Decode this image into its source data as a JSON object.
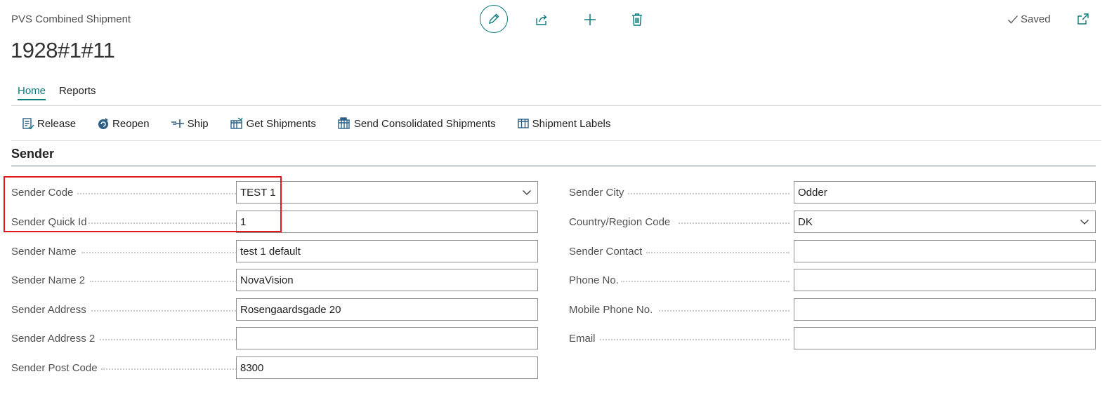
{
  "header": {
    "page_caption": "PVS Combined Shipment",
    "record_title": "1928#1#11",
    "saved_label": "Saved"
  },
  "tabs": [
    {
      "label": "Home",
      "active": true
    },
    {
      "label": "Reports",
      "active": false
    }
  ],
  "actions": [
    {
      "label": "Release",
      "icon": "release-icon"
    },
    {
      "label": "Reopen",
      "icon": "reopen-icon"
    },
    {
      "label": "Ship",
      "icon": "ship-icon"
    },
    {
      "label": "Get Shipments",
      "icon": "get-shipments-icon"
    },
    {
      "label": "Send Consolidated Shipments",
      "icon": "send-consolidated-icon"
    },
    {
      "label": "Shipment Labels",
      "icon": "shipment-labels-icon"
    }
  ],
  "section": {
    "title": "Sender",
    "left_fields": [
      {
        "label": "Sender Code",
        "value": "TEST 1",
        "dropdown": true
      },
      {
        "label": "Sender Quick Id",
        "value": "1",
        "dropdown": false
      },
      {
        "label": "Sender Name",
        "value": "test 1 default",
        "dropdown": false
      },
      {
        "label": "Sender Name 2",
        "value": "NovaVision",
        "dropdown": false
      },
      {
        "label": "Sender Address",
        "value": "Rosengaardsgade 20",
        "dropdown": false
      },
      {
        "label": "Sender Address 2",
        "value": "",
        "dropdown": false
      },
      {
        "label": "Sender Post Code",
        "value": "8300",
        "dropdown": false
      }
    ],
    "right_fields": [
      {
        "label": "Sender City",
        "value": "Odder",
        "dropdown": false
      },
      {
        "label": "Country/Region Code",
        "value": "DK",
        "dropdown": true
      },
      {
        "label": "Sender Contact",
        "value": "",
        "dropdown": false
      },
      {
        "label": "Phone No.",
        "value": "",
        "dropdown": false
      },
      {
        "label": "Mobile Phone No.",
        "value": "",
        "dropdown": false
      },
      {
        "label": "Email",
        "value": "",
        "dropdown": false
      }
    ]
  },
  "colors": {
    "accent": "#0b7a7a",
    "highlight_box": "#e0191c"
  }
}
